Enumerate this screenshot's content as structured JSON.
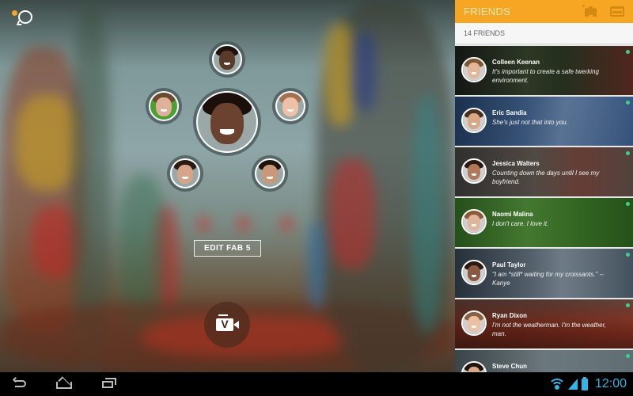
{
  "app": {
    "chat_icon": "chat-bubble-icon",
    "notification_dot_color": "#f5a623"
  },
  "fab5": {
    "center": {
      "name": "center-friend",
      "skin": "#6b4230",
      "hair": "#1a0f0a"
    },
    "orbit": [
      {
        "position": "top",
        "skin": "#5a3a28",
        "hair": "#1b120c"
      },
      {
        "position": "left",
        "skin": "#e0b09a",
        "hair": "#6a4a30",
        "bg": "#4ca030"
      },
      {
        "position": "right",
        "skin": "#efc0a5",
        "hair": "#a27250"
      },
      {
        "position": "bottom-left",
        "skin": "#d6a488",
        "hair": "#2a1a12"
      },
      {
        "position": "bottom-right",
        "skin": "#c89878",
        "hair": "#1e140e"
      }
    ],
    "edit_label": "EDIT FAB 5",
    "video_button_letter": "V",
    "video_icon": "video-camera-icon"
  },
  "panel": {
    "title": "FRIENDS",
    "add_friends_icon": "add-friends-icon",
    "inbox_icon": "inbox-icon",
    "friends_count": "14 FRIENDS",
    "accent": "#f7a623",
    "online_color": "#3ed08c",
    "friends": [
      {
        "name": "Colleen Keenan",
        "status": "It's important to create a safe twerking environment.",
        "online": true,
        "bg": "linear-gradient(90deg,#1e2420,#3d4a30 40%,#2e3a24 60%,#5a2a22)",
        "skin": "#e3b69a",
        "hair": "#7a5634"
      },
      {
        "name": "Eric Sandia",
        "status": "She's just not that into you.",
        "online": true,
        "bg": "linear-gradient(100deg,#2a4a78,#4a6fa0 40%,#6f8fb8 60%,#3a5a88)",
        "skin": "#d9a686",
        "hair": "#4a3020"
      },
      {
        "name": "Jessica Walters",
        "status": "Counting down the days until I see my boyfriend.",
        "online": true,
        "bg": "linear-gradient(90deg,#4a4a48,#6a6058 45%,#7a4a40 70%,#5a4a44)",
        "skin": "#b07a5a",
        "hair": "#2a1a12"
      },
      {
        "name": "Naomi Malina",
        "status": "I don't care. I love it.",
        "online": true,
        "bg": "linear-gradient(90deg,#3a7a2a,#5aa040 40%,#3c7a28 70%,#2a5a1c)",
        "skin": "#e2b49a",
        "hair": "#8a5a3a"
      },
      {
        "name": "Paul Taylor",
        "status": "\"I am *still* waiting for my croissants.\" --Kanye",
        "online": true,
        "bg": "linear-gradient(90deg,#3a4a5a,#6a7a88 40%,#8a9aa8 60%,#4a5a68)",
        "skin": "#8a5a40",
        "hair": "#2a1a12"
      },
      {
        "name": "Ryan Dixon",
        "status": "I'm not the weatherman. I'm the weather, man.",
        "online": true,
        "bg": "linear-gradient(180deg,#6a4a40,#8a3a2a 40%,#7a2a1c 70%,#5a2418)",
        "skin": "#ecc0a0",
        "hair": "#8a6040"
      },
      {
        "name": "Steve Chun",
        "status": "",
        "online": true,
        "bg": "linear-gradient(90deg,#5a6a70,#8a9aa0 50%,#6a7a80)",
        "skin": "#d8a88a",
        "hair": "#1e140e"
      }
    ]
  },
  "navbar": {
    "back_icon": "back-icon",
    "home_icon": "home-icon",
    "recents_icon": "recent-apps-icon",
    "wifi_icon": "wifi-icon",
    "signal_icon": "signal-icon",
    "battery_icon": "battery-icon",
    "clock": "12:00",
    "status_color": "#33b5e5"
  }
}
